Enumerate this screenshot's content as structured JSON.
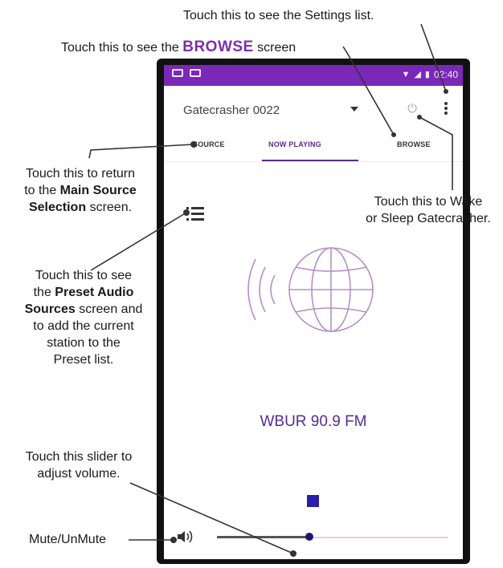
{
  "annotations": {
    "settings": "Touch this to see the Settings list.",
    "browse_before": "Touch this to see the",
    "browse_word": "BROWSE",
    "browse_after": "screen",
    "source_l1": "Touch this to return",
    "source_l2_a": "to the",
    "source_l2_b": "Main Source",
    "source_l3_a": "Selection",
    "source_l3_b": "screen.",
    "wake_l1": "Touch this to Wake",
    "wake_l2": "or Sleep Gatecrasher.",
    "preset_l1": "Touch this to see",
    "preset_l2_a": "the",
    "preset_l2_b": "Preset Audio",
    "preset_l3_a": "Sources",
    "preset_l3_b": "screen and",
    "preset_l4": "to add the current",
    "preset_l5": "station to the",
    "preset_l6": "Preset list.",
    "volume_l1": "Touch this slider to",
    "volume_l2": "adjust volume.",
    "mute": "Mute/UnMute"
  },
  "app": {
    "status_time": "02:40",
    "device_name": "Gatecrasher 0022",
    "tabs": {
      "source": "SOURCE",
      "now_playing": "NOW PLAYING",
      "browse": "BROWSE"
    },
    "active_tab": "NOW PLAYING",
    "station": "WBUR 90.9 FM",
    "volume_fraction": 0.4
  },
  "colors": {
    "status_bar": "#7a28b8",
    "accent": "#5a2a90",
    "annotation_accent": "#7b2fa8",
    "slider_track": "#f0c3ee",
    "stop_button": "#2a1ea8"
  },
  "icons": [
    "menu-list-icon",
    "power-icon",
    "more-vert-icon",
    "globe-broadcast-icon",
    "stop-icon",
    "speaker-icon",
    "dropdown-arrow-icon"
  ]
}
